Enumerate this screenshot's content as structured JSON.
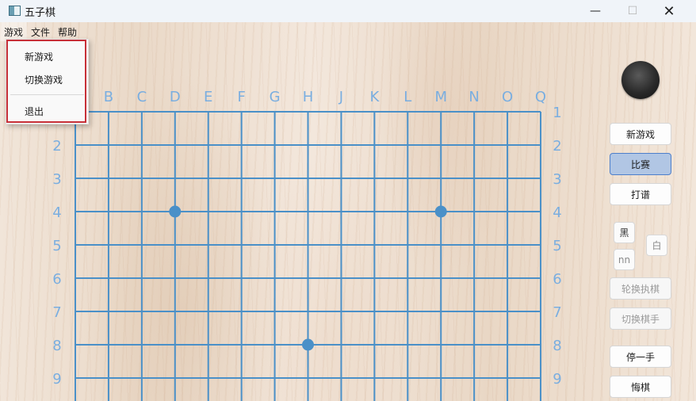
{
  "window": {
    "title": "五子棋",
    "min_symbol": "—",
    "max_symbol": "☐",
    "close_symbol": "✕"
  },
  "menubar": {
    "items": [
      "游戏",
      "文件",
      "帮助"
    ]
  },
  "dropdown": {
    "items": [
      "新游戏",
      "切换游戏",
      "退出"
    ]
  },
  "board": {
    "column_labels": [
      "B",
      "C",
      "D",
      "E",
      "F",
      "G",
      "H",
      "J",
      "K",
      "L",
      "M",
      "N",
      "O",
      "Q"
    ],
    "row_labels_left": [
      "2",
      "3",
      "4",
      "5",
      "6",
      "7",
      "8",
      "9"
    ],
    "row_labels_right": [
      "1",
      "2",
      "3",
      "4",
      "5",
      "6",
      "7",
      "8",
      "9"
    ],
    "star_points": [
      [
        "D",
        "4"
      ],
      [
        "M",
        "4"
      ],
      [
        "H",
        "8"
      ]
    ],
    "line_color": "#4a90c8",
    "label_color": "#7aaee0"
  },
  "current_stone": {
    "color": "black"
  },
  "side_panel": {
    "buttons": {
      "new_game": "新游戏",
      "match": "比赛",
      "record": "打谱",
      "rotate": "轮换执棋",
      "switch_player": "切换棋手",
      "pass": "停一手",
      "undo": "悔棋"
    },
    "small_buttons": {
      "black": "黑",
      "white": "白",
      "nn": "nn"
    }
  }
}
